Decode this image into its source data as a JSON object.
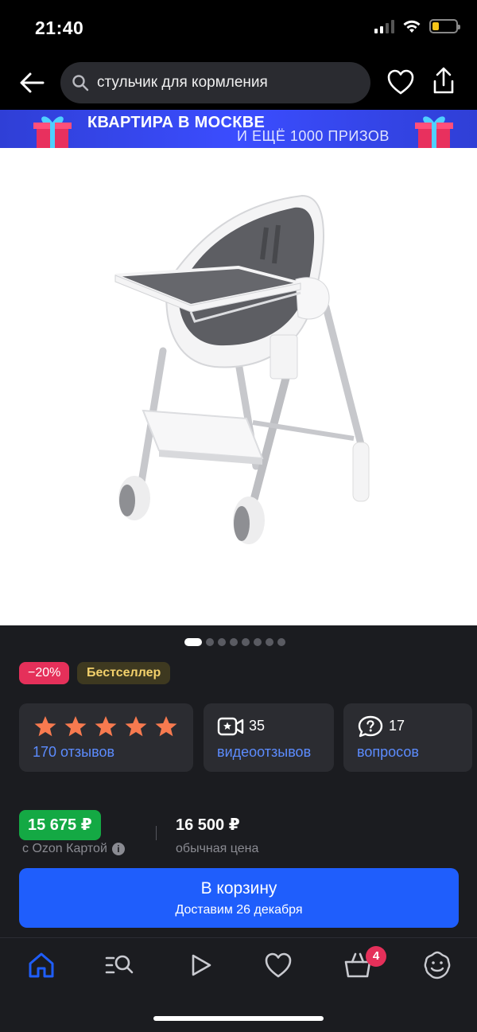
{
  "status_bar": {
    "time": "21:40"
  },
  "search": {
    "query": "стульчик для кормления"
  },
  "banner": {
    "title": "КВАРТИРА В МОСКВЕ",
    "subtitle": "И ЕЩЁ 1000 ПРИЗОВ"
  },
  "carousel": {
    "total": 8,
    "active": 1
  },
  "badges": {
    "discount": "−20%",
    "bestseller": "Бестселлер"
  },
  "rating": {
    "stars": 5,
    "reviews_label": "170 отзывов"
  },
  "video_reviews": {
    "count": "35",
    "label": "видеоотзывов"
  },
  "questions": {
    "count": "17",
    "label": "вопросов"
  },
  "price": {
    "card_price": "15 675 ₽",
    "card_note": "с Ozon Картой",
    "regular_price": "16 500 ₽",
    "regular_note": "обычная цена"
  },
  "cart_button": {
    "title": "В корзину",
    "subtitle": "Доставим 26 декабря"
  },
  "bottom_nav": {
    "items": [
      "home-icon",
      "catalog-search-icon",
      "play-icon",
      "favorites-heart-icon",
      "cart-basket-icon",
      "profile-smile-icon"
    ],
    "cart_count": "4"
  },
  "colors": {
    "accent_blue": "#1f5efc",
    "link_blue": "#5c8cff",
    "green_price": "#14a944",
    "discount_red": "#e5305a",
    "star_orange": "#f77a4f"
  }
}
